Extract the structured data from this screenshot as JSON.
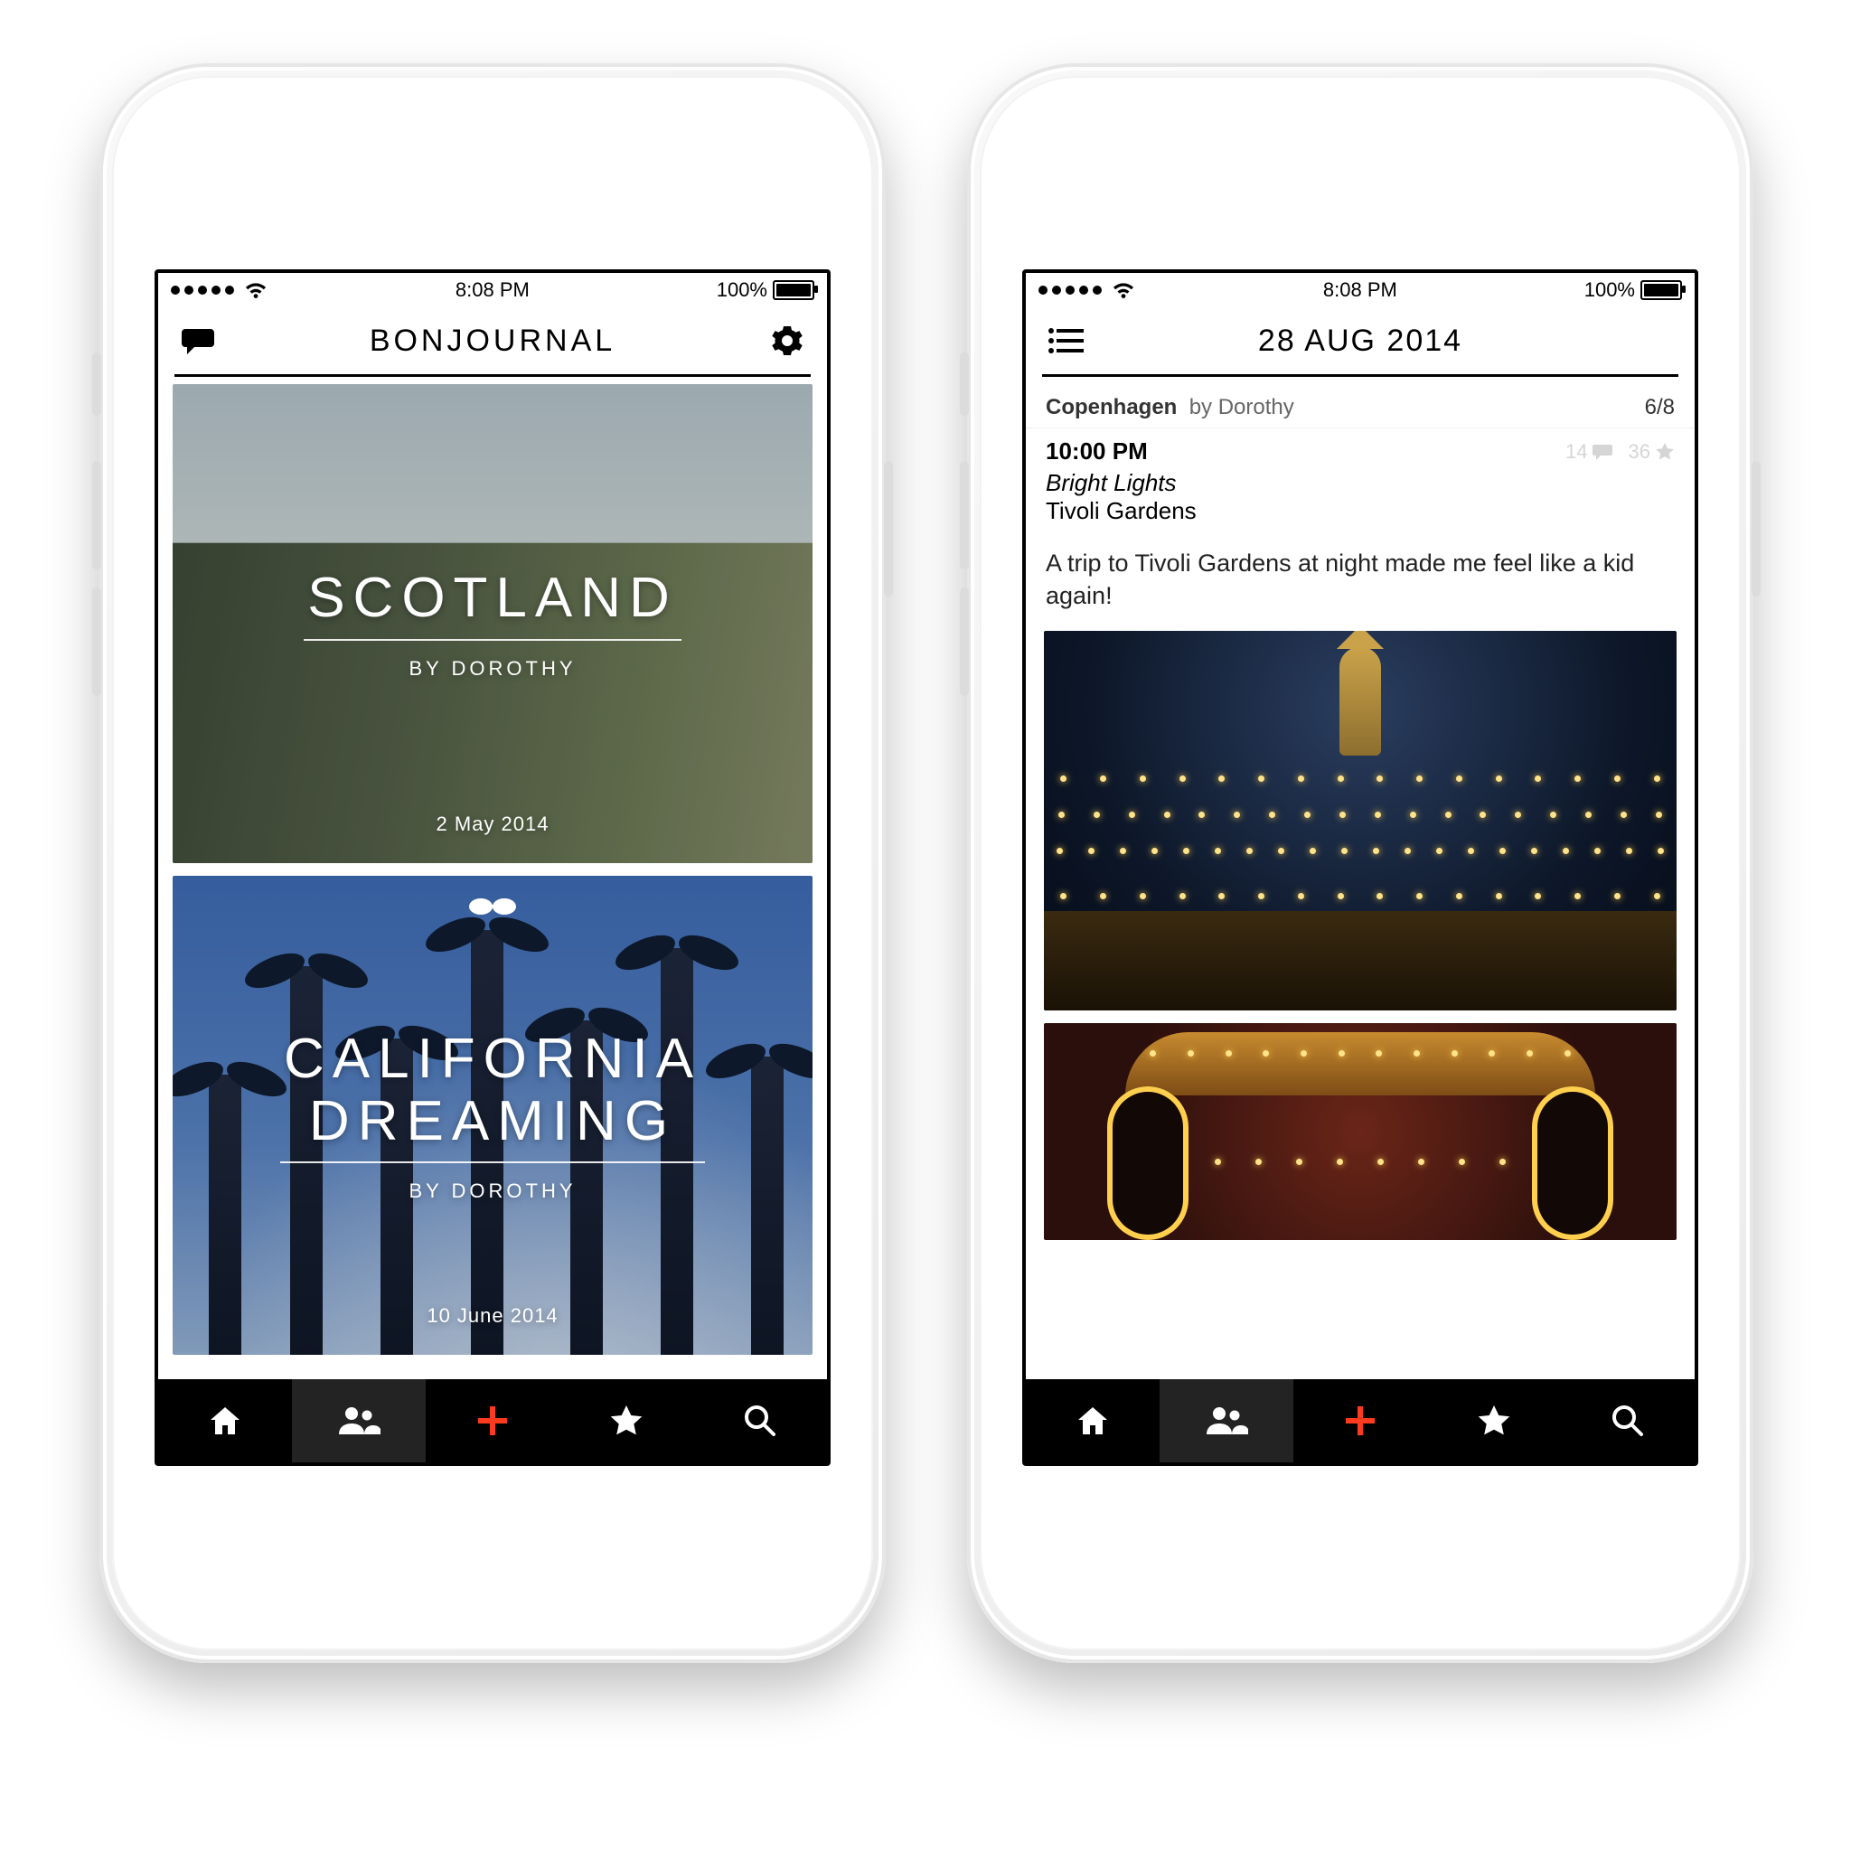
{
  "statusbar": {
    "time": "8:08 PM",
    "battery_label": "100%"
  },
  "screen_home": {
    "title": "BONJOURNAL",
    "cards": [
      {
        "title": "SCOTLAND",
        "byline": "BY DOROTHY",
        "date": "2 May 2014"
      },
      {
        "title": "CALIFORNIA\nDREAMING",
        "byline": "BY DOROTHY",
        "date": "10 June 2014"
      }
    ]
  },
  "screen_detail": {
    "title": "28 AUG 2014",
    "subheader": {
      "location": "Copenhagen",
      "by_prefix": "by",
      "author": "Dorothy",
      "page": "6/8"
    },
    "entry": {
      "time": "10:00 PM",
      "title": "Bright Lights",
      "place": "Tivoli Gardens",
      "body": "A trip to Tivoli Gardens at night made me feel like a kid again!",
      "comments": "14",
      "stars": "36"
    }
  },
  "tabs": {
    "home": "home-icon",
    "people": "people-icon",
    "add": "plus-icon",
    "star": "star-icon",
    "search": "search-icon",
    "active_left": "people",
    "active_right": "people"
  },
  "colors": {
    "accent": "#ff3b1f"
  }
}
